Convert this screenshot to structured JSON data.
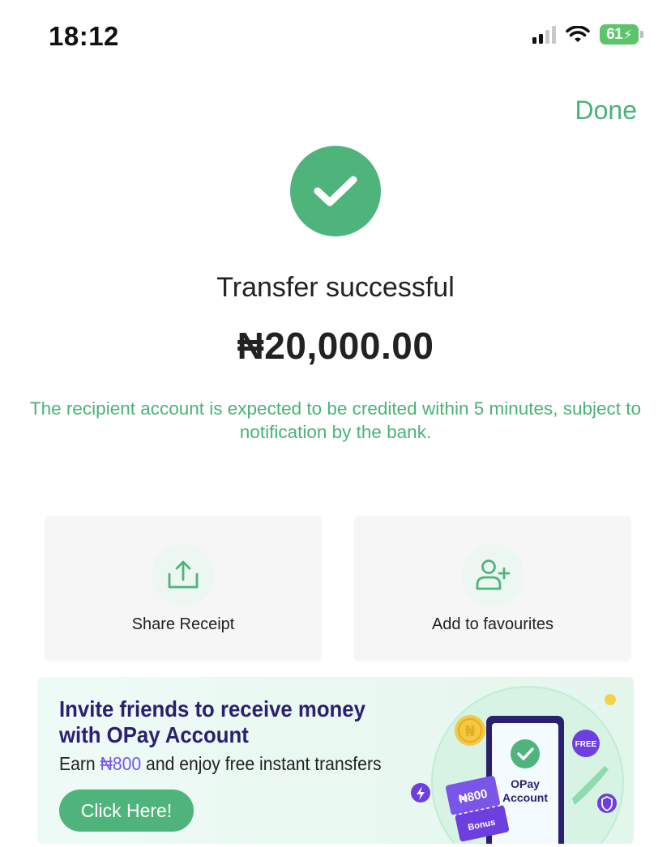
{
  "status_bar": {
    "time": "18:12",
    "battery": "61"
  },
  "header": {
    "done_label": "Done"
  },
  "result": {
    "title": "Transfer successful",
    "amount": "₦20,000.00",
    "notice": "The recipient account is expected to be credited within 5 minutes, subject to notification by the bank."
  },
  "actions": [
    {
      "label": "Share Receipt",
      "icon": "share-upload-icon"
    },
    {
      "label": "Add to favourites",
      "icon": "add-user-icon"
    }
  ],
  "banner": {
    "headline_line1": "Invite friends to receive money",
    "headline_line2": "with OPay Account",
    "sub_prefix": "Earn ",
    "sub_highlight": "₦800",
    "sub_suffix": " and enjoy free instant transfers",
    "cta_label": "Click Here!",
    "art": {
      "ticket_amount": "₦800",
      "ticket_caption": "Bonus",
      "phone_line1": "OPay",
      "phone_line2": "Account",
      "free_badge": "FREE"
    }
  },
  "colors": {
    "brand_green": "#4fb47c",
    "text_green": "#49b27a",
    "banner_purple": "#2b1f6f",
    "highlight_purple": "#7a55e8"
  }
}
